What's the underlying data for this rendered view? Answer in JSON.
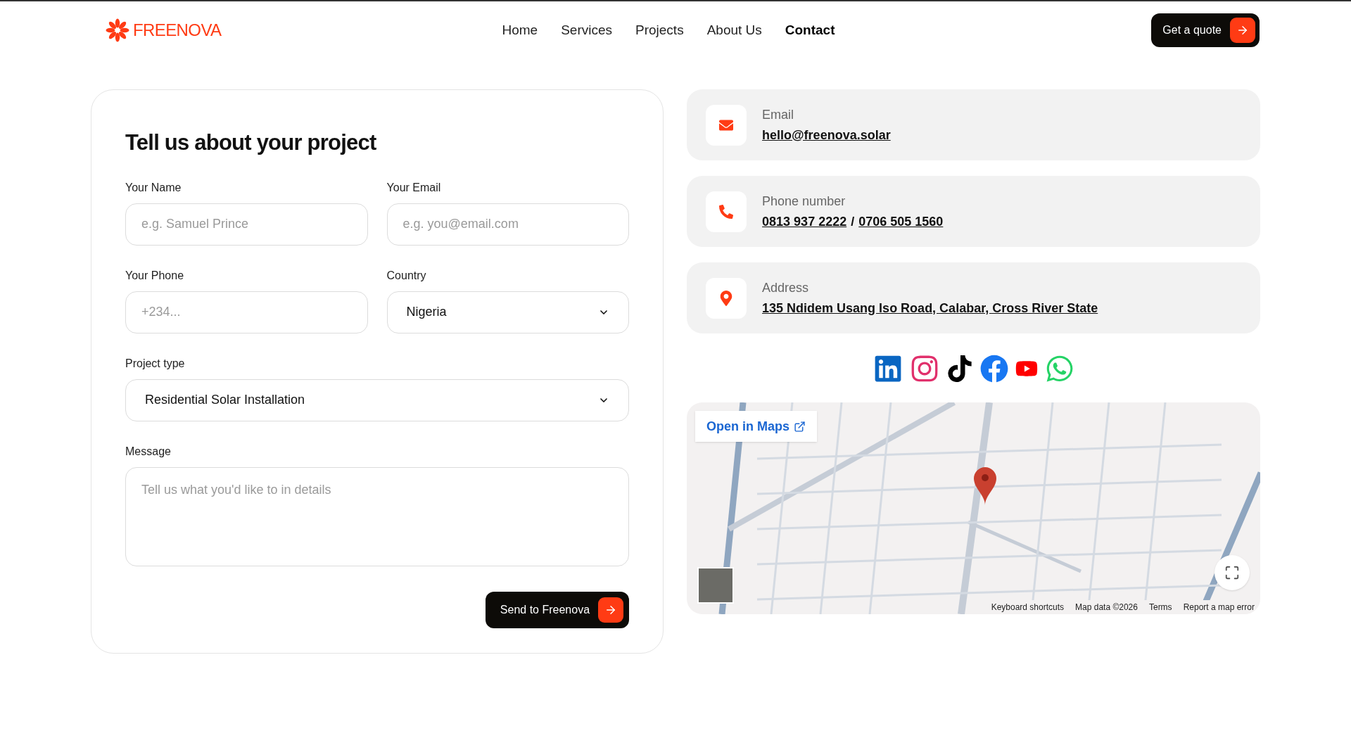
{
  "header": {
    "logo": "FREENOVA",
    "nav": [
      {
        "label": "Home",
        "selected": false
      },
      {
        "label": "Services",
        "selected": false
      },
      {
        "label": "Projects",
        "selected": false
      },
      {
        "label": "About Us",
        "selected": false
      },
      {
        "label": "Contact",
        "selected": true
      }
    ],
    "cta": "Get a quote"
  },
  "form": {
    "title": "Tell us about your project",
    "fields": [
      {
        "kind": "input",
        "label": "Your Name",
        "placeholder": "e.g. Samuel Prince",
        "wide": false
      },
      {
        "kind": "input",
        "label": "Your Email",
        "placeholder": "e.g. you@email.com",
        "wide": false
      },
      {
        "kind": "input",
        "label": "Your Phone",
        "placeholder": "+234...",
        "wide": false
      },
      {
        "kind": "select",
        "label": "Country",
        "value": "Nigeria",
        "wide": false
      },
      {
        "kind": "select",
        "label": "Project type",
        "value": "Residential Solar Installation",
        "wide": true
      },
      {
        "kind": "textarea",
        "label": "Message",
        "placeholder": "Tell us what you'd like to in details",
        "wide": true
      }
    ],
    "submit": "Send to Freenova"
  },
  "contacts": [
    {
      "kind": "email",
      "label": "Email",
      "links": [
        "hello@freenova.solar"
      ]
    },
    {
      "kind": "phone",
      "label": "Phone number",
      "links": [
        "0813 937 2222",
        "0706 505 1560"
      ],
      "separator": "/"
    },
    {
      "kind": "address",
      "label": "Address",
      "links": [
        "135 Ndidem Usang Iso Road, Calabar, Cross River State"
      ]
    }
  ],
  "map": {
    "open_link": "Open in Maps",
    "footer": [
      "Keyboard shortcuts",
      "Map data ©2026",
      "Terms",
      "Report a map error"
    ]
  }
}
